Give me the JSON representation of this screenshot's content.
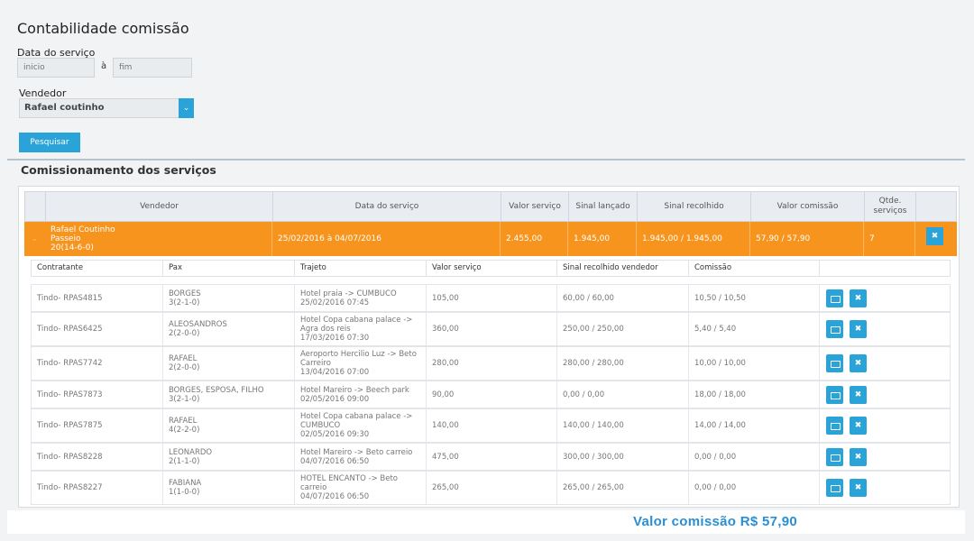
{
  "page": {
    "title": "Contabilidade comissão"
  },
  "filters": {
    "date_label": "Data do serviço",
    "start_placeholder": "inicio",
    "separator": "à",
    "end_placeholder": "fim",
    "seller_label": "Vendedor",
    "seller_value": "Rafael coutinho",
    "search_label": "Pesquisar"
  },
  "section": {
    "title": "Comissionamento dos serviços"
  },
  "table": {
    "headers": {
      "vendedor": "Vendedor",
      "data": "Data do serviço",
      "valor": "Valor serviço",
      "sinal_lancado": "Sinal lançado",
      "sinal_recolhido": "Sinal recolhido",
      "valor_comissao": "Valor comissão",
      "qtde": "Qtde. serviços"
    },
    "summary": {
      "vendedor_name": "Rafael Coutinho",
      "vendedor_type": "Passeio",
      "vendedor_pax": "20(14-6-0)",
      "data": "25/02/2016 à 04/07/2016",
      "valor": "2.455,00",
      "sinal_lancado": "1.945,00",
      "sinal_recolhido": "1.945,00 / 1.945,00",
      "valor_comissao": "57,90 / 57,90",
      "qtde": "7"
    },
    "detail_headers": {
      "contratante": "Contratante",
      "pax": "Pax",
      "trajeto": "Trajeto",
      "valor": "Valor serviço",
      "sinal": "Sinal recolhido vendedor",
      "comissao": "Comissão"
    },
    "rows": [
      {
        "contratante": "Tindo- RPAS4815",
        "pax_name": "BORGES",
        "pax_count": "3(2-1-0)",
        "trajeto": "Hotel praia -> CUMBUCO",
        "trajeto2": "",
        "data": "25/02/2016 07:45",
        "valor": "105,00",
        "sinal": "60,00 / 60,00",
        "comissao": "10,50 / 10,50"
      },
      {
        "contratante": "Tindo- RPAS6425",
        "pax_name": "ALEOSANDROS",
        "pax_count": "2(2-0-0)",
        "trajeto": "Hotel Copa cabana palace ->",
        "trajeto2": "Agra dos reis",
        "data": "17/03/2016 07:30",
        "valor": "360,00",
        "sinal": "250,00 / 250,00",
        "comissao": "5,40 / 5,40"
      },
      {
        "contratante": "Tindo- RPAS7742",
        "pax_name": "RAFAEL",
        "pax_count": "2(2-0-0)",
        "trajeto": "Aeroporto Hercilio Luz -> Beto",
        "trajeto2": "Carreiro",
        "data": "13/04/2016 07:00",
        "valor": "280,00",
        "sinal": "280,00 / 280,00",
        "comissao": "10,00 / 10,00"
      },
      {
        "contratante": "Tindo- RPAS7873",
        "pax_name": "BORGES, ESPOSA, FILHO",
        "pax_count": "3(2-1-0)",
        "trajeto": "Hotel Mareiro -> Beech park",
        "trajeto2": "",
        "data": "02/05/2016 09:00",
        "valor": "90,00",
        "sinal": "0,00 / 0,00",
        "comissao": "18,00 / 18,00"
      },
      {
        "contratante": "Tindo- RPAS7875",
        "pax_name": "RAFAEL",
        "pax_count": "4(2-2-0)",
        "trajeto": "Hotel Copa cabana palace ->",
        "trajeto2": "CUMBUCO",
        "data": "02/05/2016 09:30",
        "valor": "140,00",
        "sinal": "140,00 / 140,00",
        "comissao": "14,00 / 14,00"
      },
      {
        "contratante": "Tindo- RPAS8228",
        "pax_name": "LEONARDO",
        "pax_count": "2(1-1-0)",
        "trajeto": "Hotel Mareiro -> Beto carreio",
        "trajeto2": "",
        "data": "04/07/2016 06:50",
        "valor": "475,00",
        "sinal": "300,00 / 300,00",
        "comissao": "0,00 / 0,00"
      },
      {
        "contratante": "Tindo- RPAS8227",
        "pax_name": "FABIANA",
        "pax_count": "1(1-0-0)",
        "trajeto": "HOTEL ENCANTO -> Beto",
        "trajeto2": "carreio",
        "data": "04/07/2016 06:50",
        "valor": "265,00",
        "sinal": "265,00 / 265,00",
        "comissao": "0,00 / 0,00"
      }
    ]
  },
  "footer": {
    "total_label": "Valor comissão R$ 57,90"
  },
  "icons": {
    "dropdown": "chevron-down-icon",
    "expand": "chevron-down-icon",
    "remove": "close-icon",
    "money": "money-icon"
  },
  "colors": {
    "accent": "#2aa3d8",
    "highlight_row": "#f7941e",
    "total_text": "#2a8fd2"
  }
}
